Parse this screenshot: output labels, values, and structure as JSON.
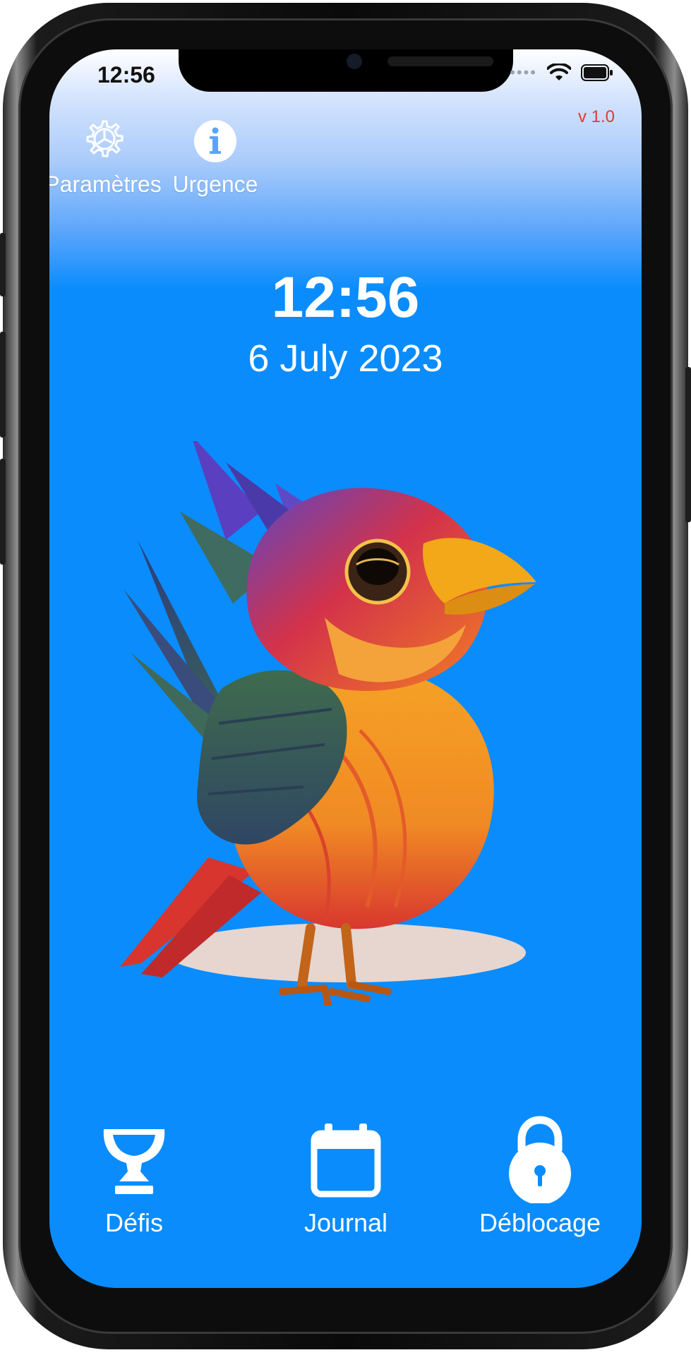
{
  "status_bar": {
    "time": "12:56",
    "signal_icon": "cellular-dots-icon",
    "wifi_icon": "wifi-icon",
    "battery_icon": "battery-icon"
  },
  "version": "v 1.0",
  "top_actions": [
    {
      "label": "Paramètres",
      "icon": "gear-icon"
    },
    {
      "label": "Urgence",
      "icon": "info-icon"
    }
  ],
  "clock": {
    "time": "12:56",
    "date": "6 July 2023"
  },
  "illustration": {
    "icon": "bird-illustration"
  },
  "bottom_actions": [
    {
      "label": "Défis",
      "icon": "trophy-icon"
    },
    {
      "label": "Journal",
      "icon": "calendar-icon"
    },
    {
      "label": "Déblocage",
      "icon": "lock-icon"
    }
  ],
  "colors": {
    "background": "#0a8cfd",
    "version": "#e53935",
    "text": "#ffffff"
  }
}
